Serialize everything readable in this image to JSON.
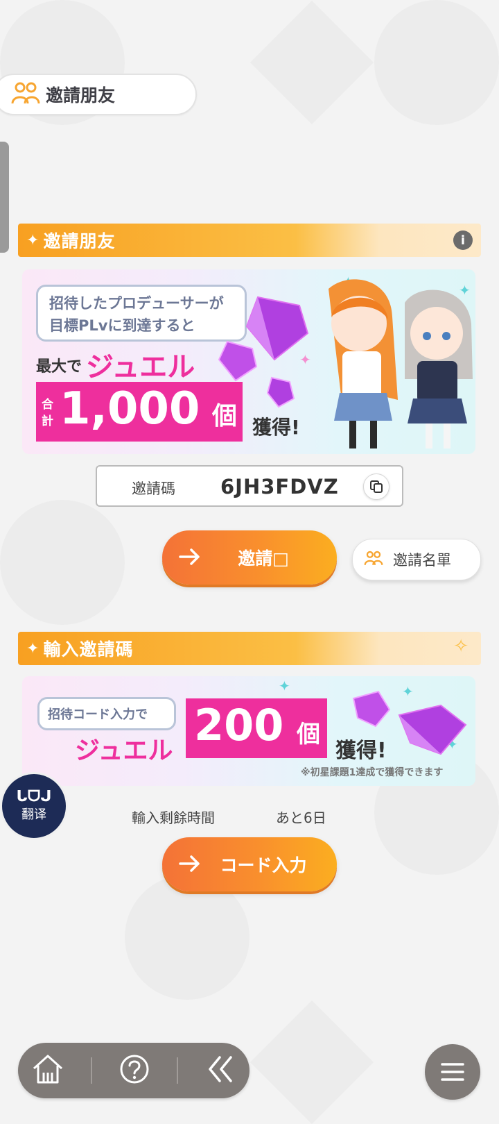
{
  "header": {
    "title": "邀請朋友"
  },
  "invite_section": {
    "title": "邀請朋友",
    "banner": {
      "bubble_line1": "招待したプロデューサーが",
      "bubble_line2": "目標PLvに到達すると",
      "prefix": "最大で",
      "reward_name": "ジュエル",
      "total_label_top": "合",
      "total_label_bottom": "計",
      "amount": "1,000",
      "unit": "個",
      "suffix": "獲得!"
    },
    "code_label": "邀請碼",
    "code_value": "6JH3FDVZ",
    "invite_button": "邀請□",
    "list_button": "邀請名單"
  },
  "input_section": {
    "title": "輸入邀請碼",
    "banner": {
      "bubble": "招待コード入力で",
      "reward_name": "ジュエル",
      "amount": "200",
      "unit": "個",
      "suffix": "獲得!",
      "note": "※初星課題1達成で獲得できます"
    },
    "remaining_label": "輸入剩餘時間",
    "remaining_value": "あと6日",
    "code_input_button": "コード入力"
  },
  "translate_fab": {
    "top": "ᒐᗜᒍ",
    "bottom": "翻译"
  },
  "bottom_nav": {
    "icons": [
      "home-icon",
      "help-icon",
      "back-icon",
      "menu-icon"
    ]
  },
  "colors": {
    "accent_orange": "#f98f2d",
    "pink": "#ee2f9d",
    "nav_gray": "#7f7a77"
  }
}
